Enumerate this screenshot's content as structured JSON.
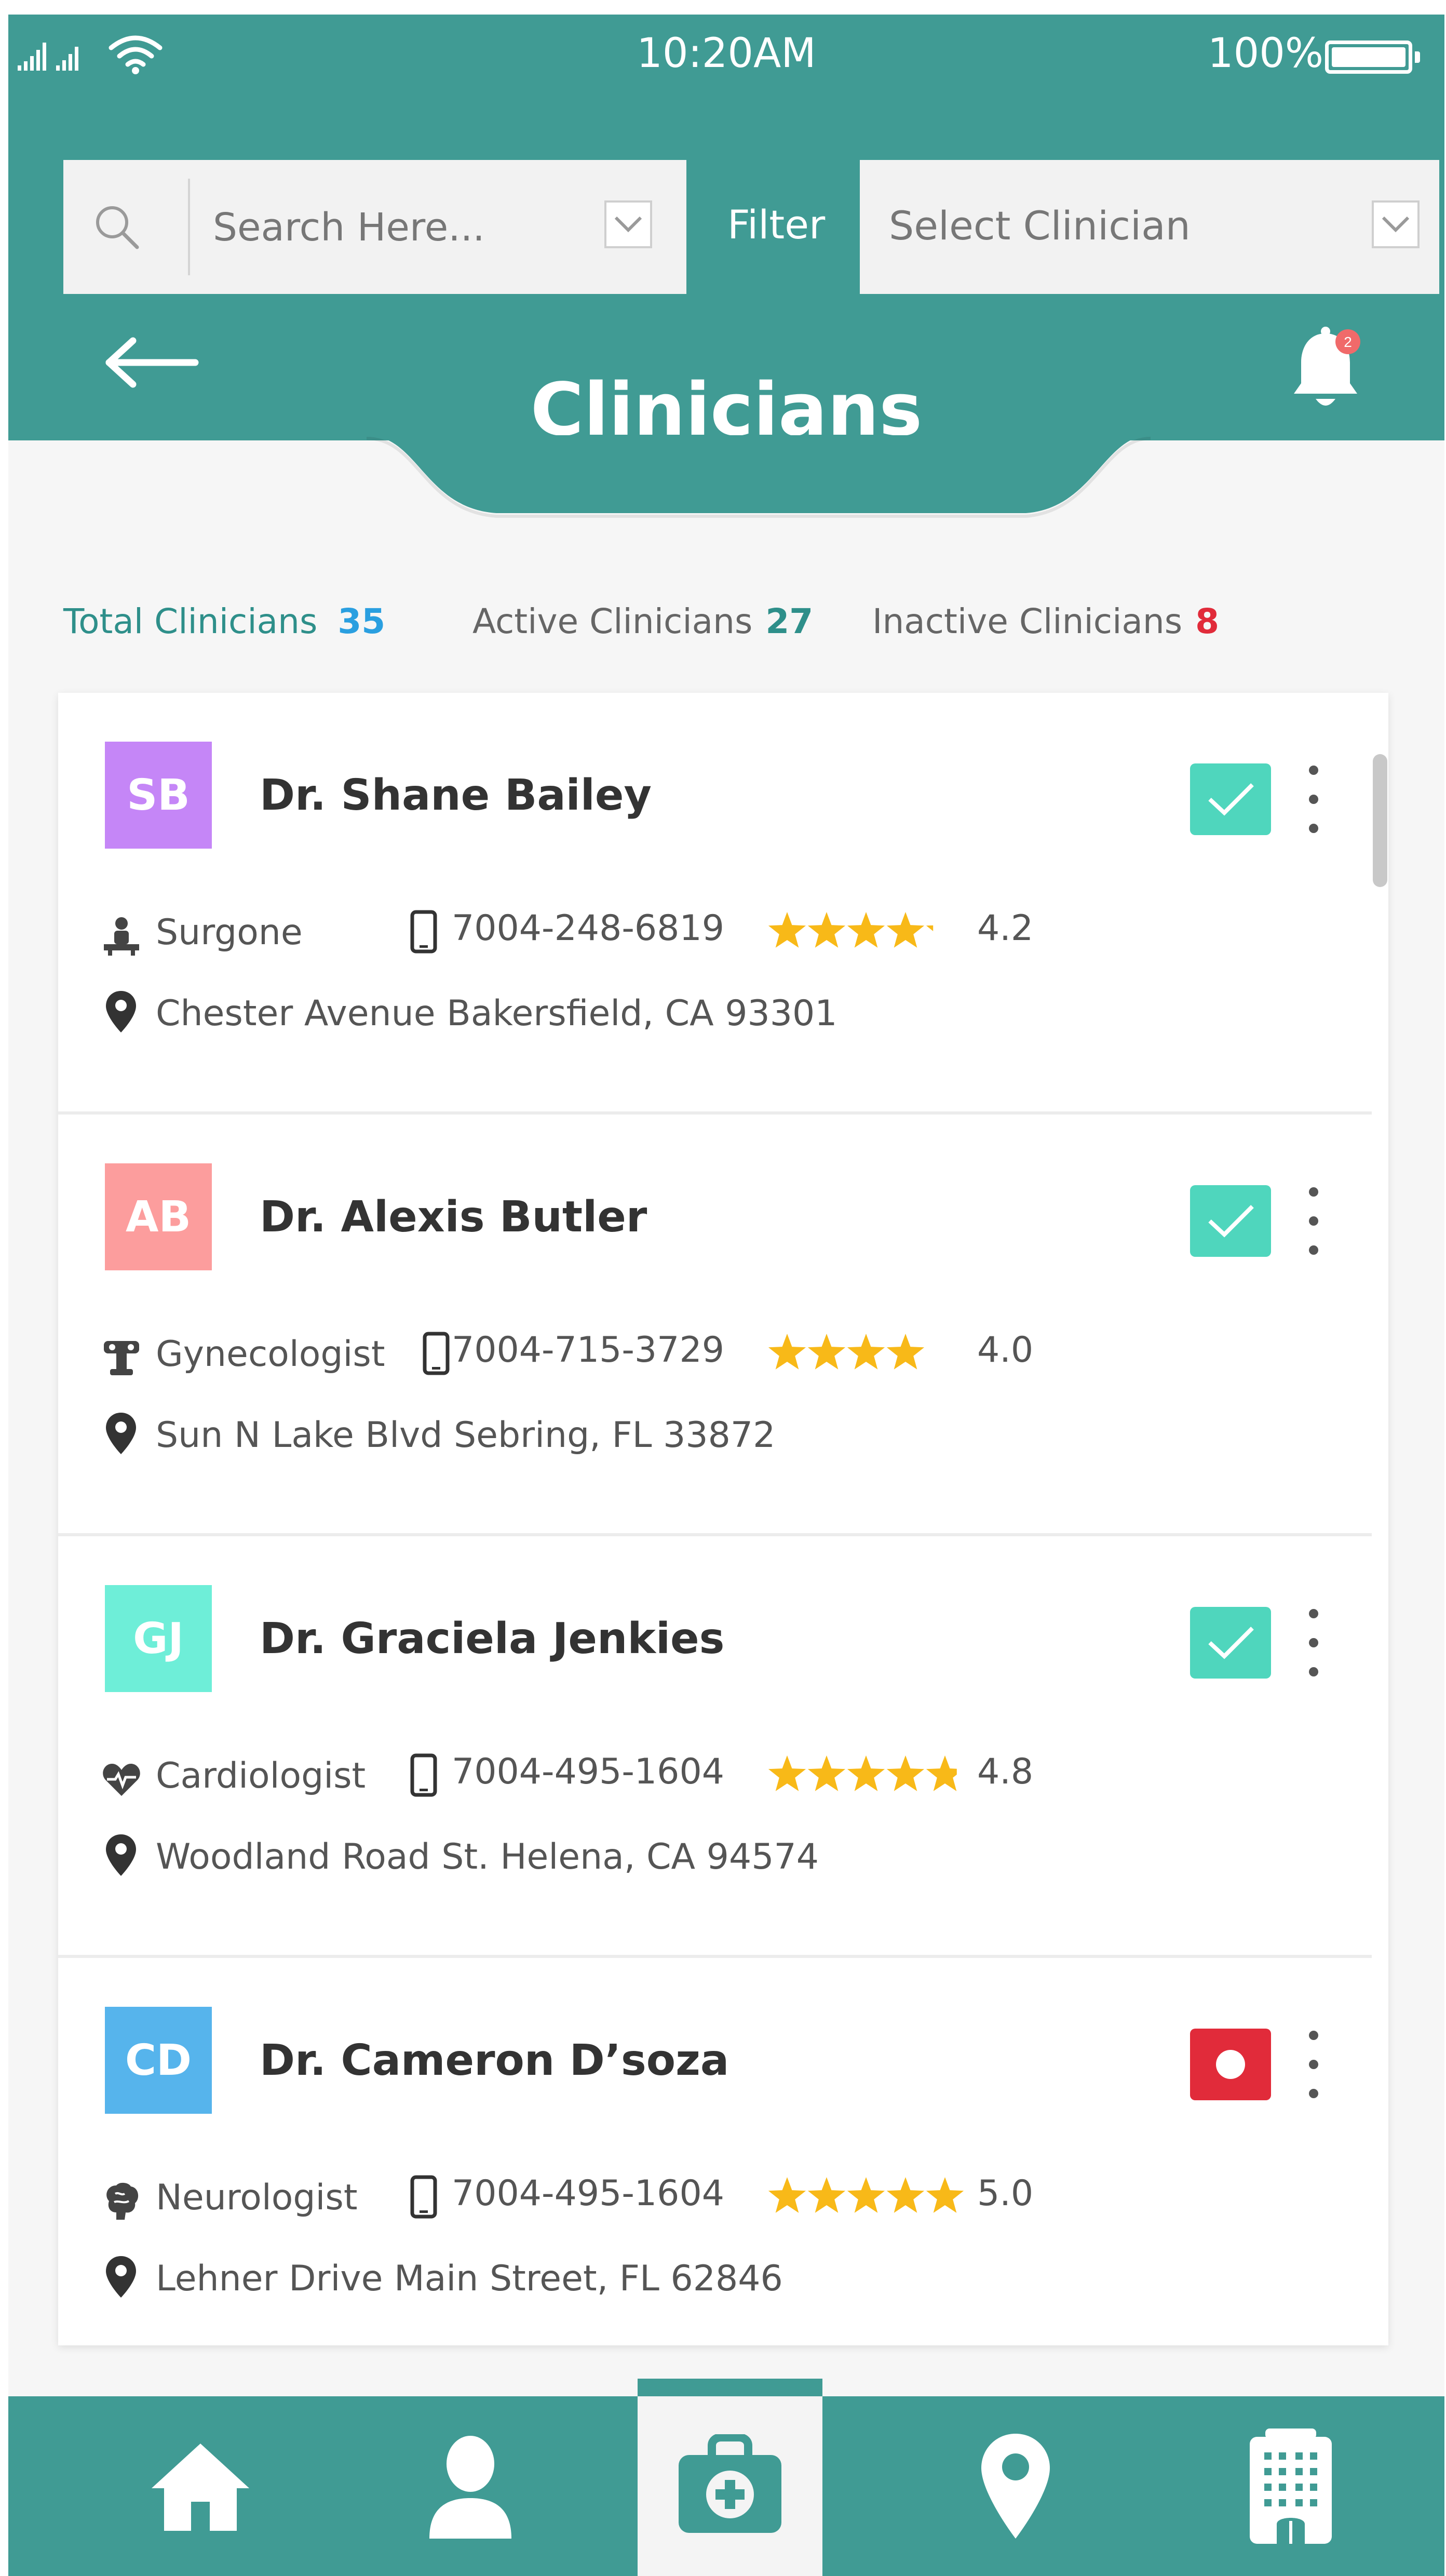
{
  "status_bar": {
    "time": "10:20AM",
    "battery": "100%"
  },
  "search": {
    "placeholder": "Search Here..."
  },
  "filter": {
    "label": "Filter",
    "select_value": "Select Clinician"
  },
  "header": {
    "title": "Clinicians",
    "notification_count": "2"
  },
  "stats": {
    "total_label": "Total Clinicians",
    "total_value": "35",
    "active_label": "Active Clinicians",
    "active_value": "27",
    "inactive_label": "Inactive Clinicians",
    "inactive_value": "8"
  },
  "clinicians": [
    {
      "initials": "SB",
      "name": "Dr. Shane Bailey",
      "specialty": "Surgone",
      "phone": "7004-248-6819",
      "rating": 4.2,
      "rating_text": "4.2",
      "address": "Chester Avenue Bakersfield, CA 93301",
      "status": "active",
      "avatar_color": "#c586f7",
      "specialty_icon": "surgeon-icon"
    },
    {
      "initials": "AB",
      "name": "Dr. Alexis Butler",
      "specialty": "Gynecologist",
      "phone": "7004-715-3729",
      "rating": 4.0,
      "rating_text": "4.0",
      "address": "Sun N Lake Blvd Sebring, FL 33872",
      "status": "active",
      "avatar_color": "#fc9d9d",
      "specialty_icon": "gynecology-icon"
    },
    {
      "initials": "GJ",
      "name": "Dr. Graciela Jenkies",
      "specialty": "Cardiologist",
      "phone": "7004-495-1604",
      "rating": 4.8,
      "rating_text": "4.8",
      "address": "Woodland Road St. Helena, CA 94574",
      "status": "active",
      "avatar_color": "#6eeed8",
      "specialty_icon": "heartbeat-icon"
    },
    {
      "initials": "CD",
      "name": "Dr. Cameron D’soza",
      "specialty": "Neurologist",
      "phone": "7004-495-1604",
      "rating": 5.0,
      "rating_text": "5.0",
      "address": "Lehner Drive Main Street, FL 62846",
      "status": "inactive",
      "avatar_color": "#56b4ec",
      "specialty_icon": "brain-icon"
    }
  ],
  "nav": {
    "items": [
      "home-icon",
      "user-icon",
      "medical-kit-icon",
      "location-icon",
      "building-icon"
    ],
    "active": "medical-kit-icon"
  },
  "colors": {
    "primary": "#409b94",
    "total_value": "#2a9fe0",
    "active_value": "#2e8f8a",
    "inactive_value": "#e12b3a",
    "star": "#f8b918",
    "active_check": "#4fd6bd",
    "inactive_status": "#e12b3a"
  }
}
